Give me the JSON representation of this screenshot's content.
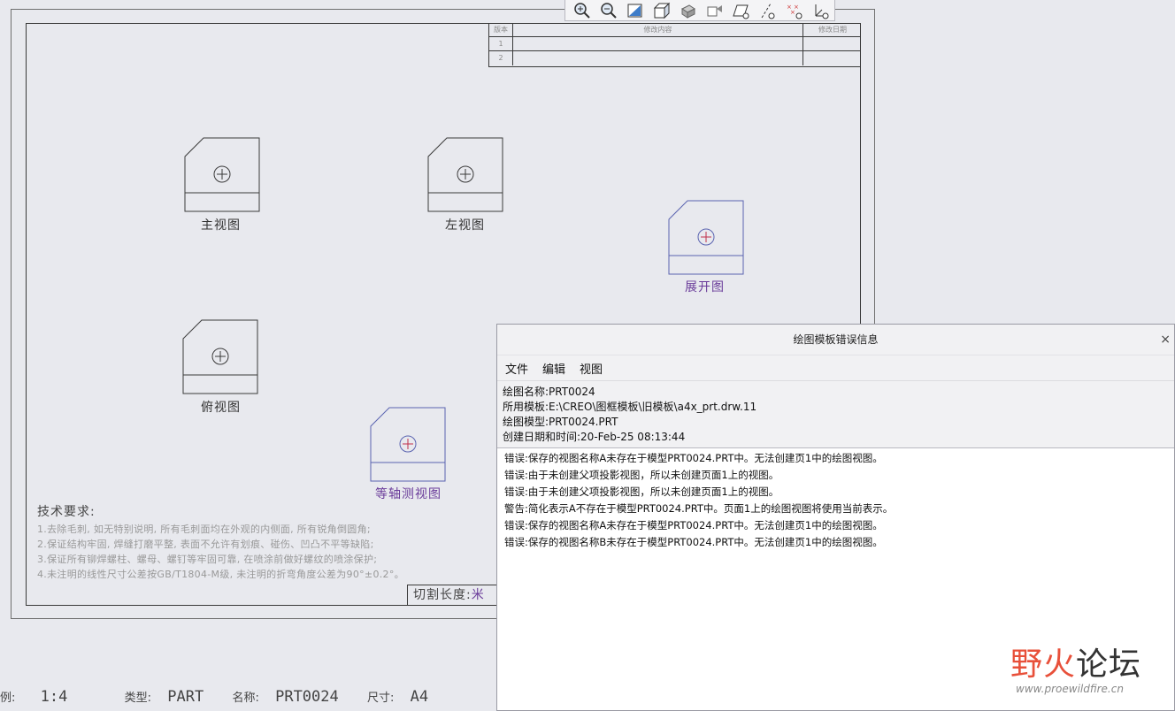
{
  "toolbar": {
    "icons": [
      "zoom-in-icon",
      "zoom-out-icon",
      "refit-icon",
      "display-style-icon",
      "saved-orientation-icon",
      "view-manager-icon",
      "datum-plane-icon",
      "datum-axis-icon",
      "datum-point-icon",
      "csys-icon"
    ]
  },
  "revision_table": {
    "headers": [
      "版本",
      "修改内容",
      "修改日期"
    ],
    "rows": [
      [
        "1",
        "",
        ""
      ],
      [
        "2",
        "",
        ""
      ]
    ]
  },
  "views": {
    "front": "主视图",
    "left": "左视图",
    "flat": "展开图",
    "top": "俯视图",
    "iso": "等轴测视图"
  },
  "tech_requirements": {
    "title": "技术要求:",
    "lines": [
      "1.去除毛刺, 如无特别说明, 所有毛刺面均在外观的内侧面, 所有锐角倒圆角;",
      "2.保证结构牢固, 焊缝打磨平整, 表面不允许有划痕、碰伤、凹凸不平等缺陷;",
      "3.保证所有铆焊螺柱、螺母、螺钉等牢固可靠, 在喷涂前做好螺纹的喷涂保护;",
      "4.未注明的线性尺寸公差按GB/T1804-M级, 未注明的折弯角度公差为90°±0.2°。"
    ]
  },
  "cut_length": {
    "label": "切割长度:",
    "value": "米"
  },
  "status": {
    "scale_label": "例:",
    "scale_value": "1:4",
    "type_label": "类型:",
    "type_value": "PART",
    "name_label": "名称:",
    "name_value": "PRT0024",
    "size_label": "尺寸:",
    "size_value": "A4"
  },
  "dialog": {
    "title": "绘图模板错误信息",
    "close": "×",
    "menu": [
      "文件",
      "编辑",
      "视图"
    ],
    "info": [
      "绘图名称:PRT0024",
      "所用模板:E:\\CREO\\图框模板\\旧模板\\a4x_prt.drw.11",
      "绘图模型:PRT0024.PRT",
      "创建日期和时间:20-Feb-25 08:13:44"
    ],
    "log": [
      "错误:保存的视图名称A未存在于模型PRT0024.PRT中。无法创建页1中的绘图视图。",
      "错误:由于未创建父项投影视图，所以未创建页面1上的视图。",
      "错误:由于未创建父项投影视图，所以未创建页面1上的视图。",
      "警告:简化表示A不存在于模型PRT0024.PRT中。页面1上的绘图视图将使用当前表示。",
      "错误:保存的视图名称A未存在于模型PRT0024.PRT中。无法创建页1中的绘图视图。",
      "错误:保存的视图名称B未存在于模型PRT0024.PRT中。无法创建页1中的绘图视图。"
    ]
  },
  "watermark": {
    "ye": "野",
    "huo": "火",
    "rest": "论坛",
    "url": "www.proewildfire.cn"
  },
  "colors": {
    "selected_view": "#5a63b0",
    "view_label_selected": "#6a3c9a",
    "line": "#3a3a3a"
  }
}
